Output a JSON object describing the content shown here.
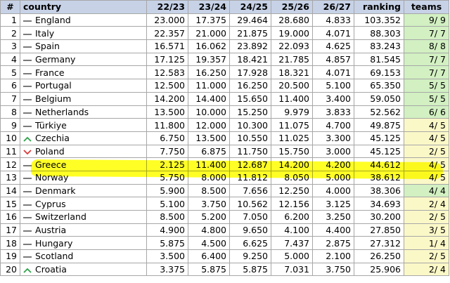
{
  "table": {
    "headers": [
      "#",
      "country",
      "22/23",
      "23/24",
      "24/25",
      "25/26",
      "26/27",
      "ranking",
      "teams"
    ],
    "rows": [
      {
        "rank": "1",
        "trend": "flat",
        "country": "England",
        "v1": "23.000",
        "v2": "17.375",
        "v3": "29.464",
        "v4": "28.680",
        "v5": "4.833",
        "ranking": "103.352",
        "teams": "9/ 9",
        "teams_status": "green"
      },
      {
        "rank": "2",
        "trend": "flat",
        "country": "Italy",
        "v1": "22.357",
        "v2": "21.000",
        "v3": "21.875",
        "v4": "19.000",
        "v5": "4.071",
        "ranking": "88.303",
        "teams": "7/ 7",
        "teams_status": "green"
      },
      {
        "rank": "3",
        "trend": "flat",
        "country": "Spain",
        "v1": "16.571",
        "v2": "16.062",
        "v3": "23.892",
        "v4": "22.093",
        "v5": "4.625",
        "ranking": "83.243",
        "teams": "8/ 8",
        "teams_status": "green"
      },
      {
        "rank": "4",
        "trend": "flat",
        "country": "Germany",
        "v1": "17.125",
        "v2": "19.357",
        "v3": "18.421",
        "v4": "21.785",
        "v5": "4.857",
        "ranking": "81.545",
        "teams": "7/ 7",
        "teams_status": "green"
      },
      {
        "rank": "5",
        "trend": "flat",
        "country": "France",
        "v1": "12.583",
        "v2": "16.250",
        "v3": "17.928",
        "v4": "18.321",
        "v5": "4.071",
        "ranking": "69.153",
        "teams": "7/ 7",
        "teams_status": "green"
      },
      {
        "rank": "6",
        "trend": "flat",
        "country": "Portugal",
        "v1": "12.500",
        "v2": "11.000",
        "v3": "16.250",
        "v4": "20.500",
        "v5": "5.100",
        "ranking": "65.350",
        "teams": "5/ 5",
        "teams_status": "green"
      },
      {
        "rank": "7",
        "trend": "flat",
        "country": "Belgium",
        "v1": "14.200",
        "v2": "14.400",
        "v3": "15.650",
        "v4": "11.400",
        "v5": "3.400",
        "ranking": "59.050",
        "teams": "5/ 5",
        "teams_status": "green"
      },
      {
        "rank": "8",
        "trend": "flat",
        "country": "Netherlands",
        "v1": "13.500",
        "v2": "10.000",
        "v3": "15.250",
        "v4": "9.979",
        "v5": "3.833",
        "ranking": "52.562",
        "teams": "6/ 6",
        "teams_status": "green"
      },
      {
        "rank": "9",
        "trend": "flat",
        "country": "Türkiye",
        "v1": "11.800",
        "v2": "12.000",
        "v3": "10.300",
        "v4": "11.075",
        "v5": "4.700",
        "ranking": "49.875",
        "teams": "4/ 5",
        "teams_status": "yellow"
      },
      {
        "rank": "10",
        "trend": "up",
        "country": "Czechia",
        "v1": "6.750",
        "v2": "13.500",
        "v3": "10.550",
        "v4": "11.025",
        "v5": "3.300",
        "ranking": "45.125",
        "teams": "4/ 5",
        "teams_status": "yellow"
      },
      {
        "rank": "11",
        "trend": "down",
        "country": "Poland",
        "v1": "7.750",
        "v2": "6.875",
        "v3": "11.750",
        "v4": "15.750",
        "v5": "3.000",
        "ranking": "45.125",
        "teams": "2/ 5",
        "teams_status": "yellow"
      },
      {
        "rank": "12",
        "trend": "flat",
        "country": "Greece",
        "v1": "2.125",
        "v2": "11.400",
        "v3": "12.687",
        "v4": "14.200",
        "v5": "4.200",
        "ranking": "44.612",
        "teams": "4/ 5",
        "teams_status": "yellow"
      },
      {
        "rank": "13",
        "trend": "flat",
        "country": "Norway",
        "v1": "5.750",
        "v2": "8.000",
        "v3": "11.812",
        "v4": "8.050",
        "v5": "5.000",
        "ranking": "38.612",
        "teams": "4/ 5",
        "teams_status": "yellow"
      },
      {
        "rank": "14",
        "trend": "flat",
        "country": "Denmark",
        "v1": "5.900",
        "v2": "8.500",
        "v3": "7.656",
        "v4": "12.250",
        "v5": "4.000",
        "ranking": "38.306",
        "teams": "4/ 4",
        "teams_status": "green"
      },
      {
        "rank": "15",
        "trend": "flat",
        "country": "Cyprus",
        "v1": "5.100",
        "v2": "3.750",
        "v3": "10.562",
        "v4": "12.156",
        "v5": "3.125",
        "ranking": "34.693",
        "teams": "2/ 4",
        "teams_status": "yellow"
      },
      {
        "rank": "16",
        "trend": "flat",
        "country": "Switzerland",
        "v1": "8.500",
        "v2": "5.200",
        "v3": "7.050",
        "v4": "6.200",
        "v5": "3.250",
        "ranking": "30.200",
        "teams": "2/ 5",
        "teams_status": "yellow"
      },
      {
        "rank": "17",
        "trend": "flat",
        "country": "Austria",
        "v1": "4.900",
        "v2": "4.800",
        "v3": "9.650",
        "v4": "4.100",
        "v5": "4.400",
        "ranking": "27.850",
        "teams": "3/ 5",
        "teams_status": "yellow"
      },
      {
        "rank": "18",
        "trend": "flat",
        "country": "Hungary",
        "v1": "5.875",
        "v2": "4.500",
        "v3": "6.625",
        "v4": "7.437",
        "v5": "2.875",
        "ranking": "27.312",
        "teams": "1/ 4",
        "teams_status": "yellow"
      },
      {
        "rank": "19",
        "trend": "flat",
        "country": "Scotland",
        "v1": "3.500",
        "v2": "6.400",
        "v3": "9.250",
        "v4": "5.000",
        "v5": "2.100",
        "ranking": "26.250",
        "teams": "2/ 5",
        "teams_status": "yellow"
      },
      {
        "rank": "20",
        "trend": "up",
        "country": "Croatia",
        "v1": "3.375",
        "v2": "5.875",
        "v3": "5.875",
        "v4": "7.031",
        "v5": "3.750",
        "ranking": "25.906",
        "teams": "2/ 4",
        "teams_status": "yellow"
      }
    ]
  },
  "colors": {
    "header_bg": "#c7d2e7",
    "teams_full": "#d2f0c2",
    "teams_partial": "#fbf8c8",
    "trend_up": "#2fa14b",
    "trend_down": "#d83a3a",
    "highlighter": "#ffff00"
  },
  "highlighted_row": "12"
}
